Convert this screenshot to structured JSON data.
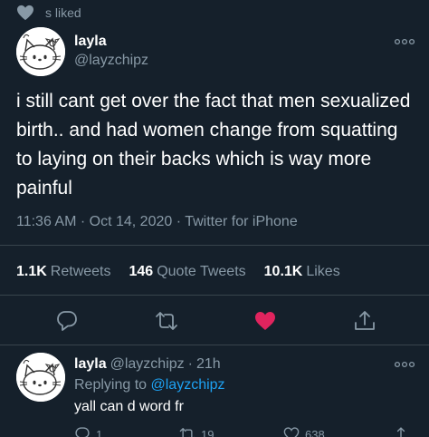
{
  "liked_by": "s liked",
  "tweet": {
    "name": "layla",
    "handle": "@layzchipz",
    "text": "i still cant get over the fact that men sexualized birth.. and had women change from squatting to laying on their backs which is way more painful",
    "time": "11:36 AM",
    "date": "Oct 14, 2020",
    "source": "Twitter for iPhone",
    "retweets_count": "1.1K",
    "retweets_label": "Retweets",
    "quote_count": "146",
    "quote_label": "Quote Tweets",
    "likes_count": "10.1K",
    "likes_label": "Likes"
  },
  "reply": {
    "name": "layla",
    "handle": "@layzchipz",
    "age": "21h",
    "replying_label": "Replying to",
    "replying_to": "@layzchipz",
    "text": "yall can d word fr",
    "reply_count": "1",
    "retweet_count": "19",
    "like_count": "638"
  },
  "colors": {
    "background": "#15202b",
    "secondary_text": "#8899a6",
    "like": "#e0245e",
    "link": "#1da1f2",
    "divider": "#38444d"
  },
  "icons": [
    "heart-icon",
    "more-icon",
    "reply-icon",
    "retweet-icon",
    "like-icon",
    "share-icon"
  ]
}
